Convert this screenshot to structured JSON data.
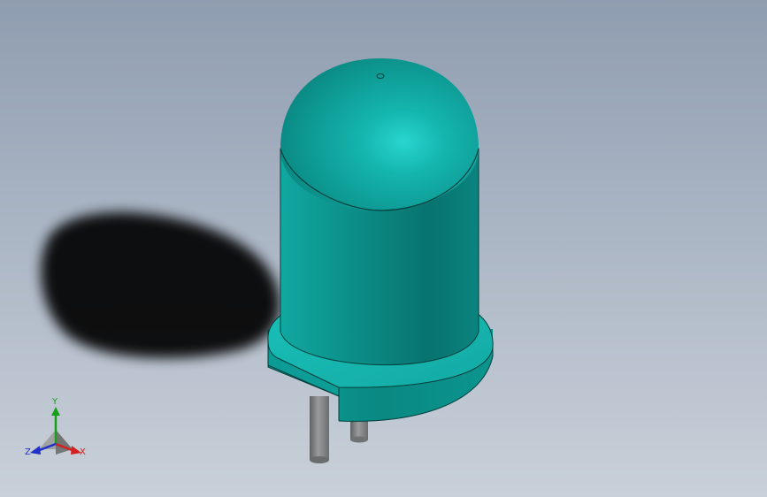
{
  "viewport": {
    "background_top": "#8f9db0",
    "background_bottom": "#c9d0d9"
  },
  "model": {
    "part": "led",
    "body_color": "#0f8f8a",
    "dome_color": "#13a9a3",
    "flange_color": "#17b3ad",
    "lead_color": "#7c7f80"
  },
  "triad": {
    "x_label": "X",
    "y_label": "Y",
    "z_label": "Z",
    "x_color": "#d42020",
    "y_color": "#18a018",
    "z_color": "#2030c8"
  }
}
